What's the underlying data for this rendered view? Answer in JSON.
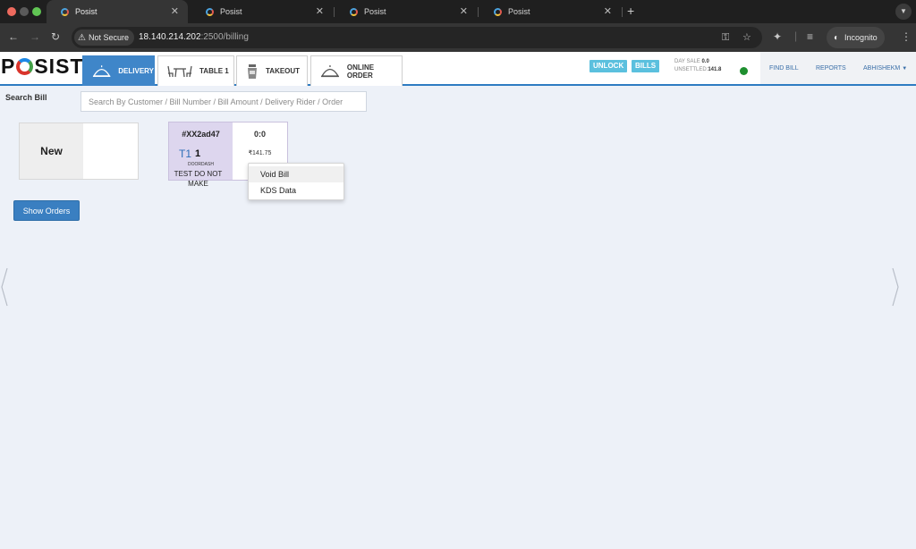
{
  "browser": {
    "tabs": [
      {
        "title": "Posist",
        "active": true
      },
      {
        "title": "Posist",
        "active": false
      },
      {
        "title": "Posist",
        "active": false
      },
      {
        "title": "Posist",
        "active": false
      }
    ],
    "new_tab_symbol": "+",
    "security_label": "Not Secure",
    "url_host": "18.140.214.202",
    "url_path": ":2500/billing",
    "profile_label": "Incognito",
    "traffic_colors": [
      "#ed6a5e",
      "#5a5a5a",
      "#61c554"
    ]
  },
  "header": {
    "logo": {
      "p": "P",
      "rest": "SIST"
    },
    "nav": [
      {
        "label": "DELIVERY",
        "icon": "delivery-icon",
        "active": true
      },
      {
        "label": "TABLE 1",
        "icon": "table-icon",
        "active": false
      },
      {
        "label": "TAKEOUT",
        "icon": "takeout-cup-icon",
        "active": false
      },
      {
        "label": "ONLINE ORDER",
        "icon": "online-order-cloche-icon",
        "active": false
      }
    ],
    "unlock_label": "UNLOCK",
    "bills_label": "BILLS",
    "day_sale_label": "DAY SALE",
    "day_sale_value": "0.0",
    "unsettled_label": "UNSETTLED",
    "unsettled_value": "141.8",
    "find_bill_label": "FIND BILL",
    "reports_label": "REPORTS",
    "user_label": "ABHISHEKM",
    "status_color": "#1e8f2f",
    "accent_color": "#3f86c9"
  },
  "search": {
    "label": "Search Bill",
    "placeholder": "Search By Customer / Bill Number / Bill Amount / Delivery Rider / Order",
    "value": ""
  },
  "new_card": {
    "label": "New"
  },
  "bill_card": {
    "bill_no": "#XX2ad47",
    "table": "T1",
    "guests": "1",
    "source": "DOORDASH",
    "time": "0:0",
    "amount": "₹141.75",
    "customer_line1": "TEST DO NOT",
    "customer_line2": "MAKE"
  },
  "context_menu": {
    "items": [
      "Void Bill",
      "KDS Data"
    ]
  },
  "show_orders_label": "Show Orders"
}
